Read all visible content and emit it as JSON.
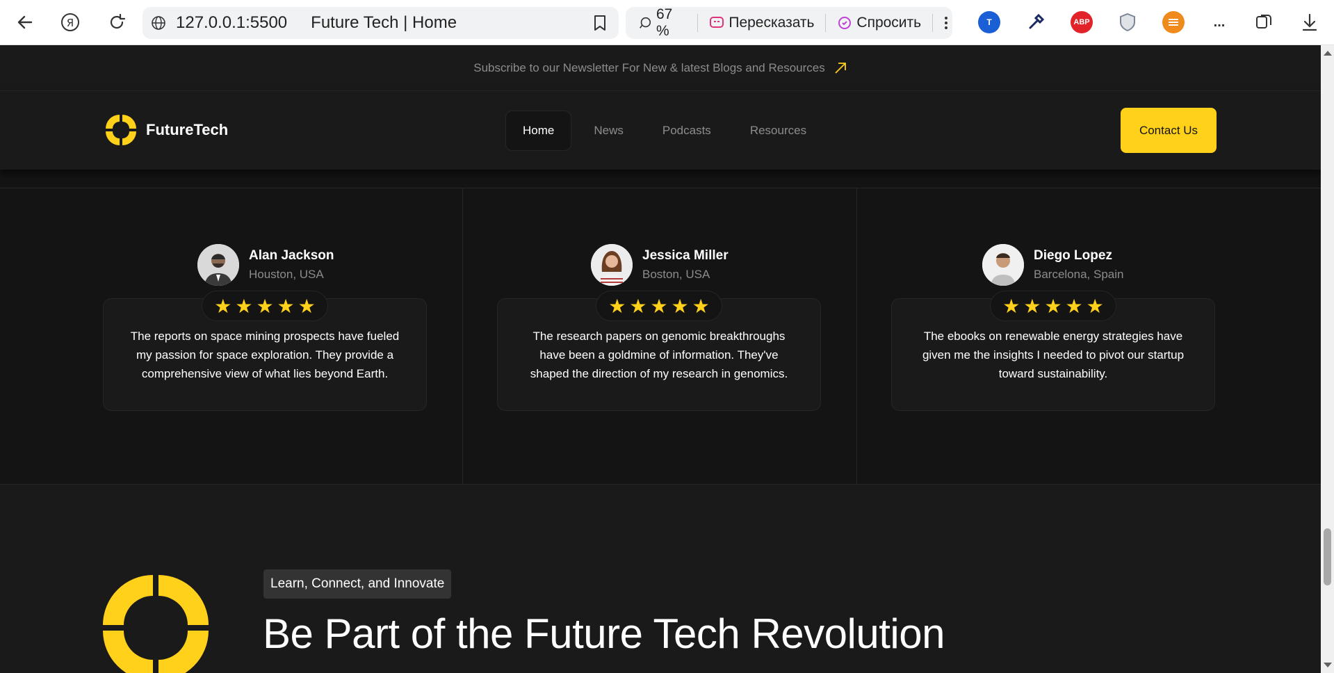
{
  "browser": {
    "url": "127.0.0.1:5500",
    "tab_title": "Future Tech | Home",
    "zoom": "67 %",
    "retell_label": "Пересказать",
    "ask_label": "Спросить",
    "more_label": "...",
    "abp_label": "ABP"
  },
  "newsletter": {
    "text": "Subscribe to our Newsletter For New & latest Blogs and Resources"
  },
  "header": {
    "brand": "FutureTech",
    "nav": [
      "Home",
      "News",
      "Podcasts",
      "Resources"
    ],
    "active_nav": "Home",
    "contact_label": "Contact Us",
    "accent_color": "#FFD11A"
  },
  "testimonials": [
    {
      "name": "Alan Jackson",
      "location": "Houston, USA",
      "rating": 5,
      "text": "The reports on space mining prospects have fueled my passion for space exploration. They provide a comprehensive view of what lies beyond Earth."
    },
    {
      "name": "Jessica Miller",
      "location": "Boston, USA",
      "rating": 5,
      "text": "The research papers on genomic breakthroughs have been a goldmine of information. They've shaped the direction of my research in genomics."
    },
    {
      "name": "Diego Lopez",
      "location": "Barcelona, Spain",
      "rating": 5,
      "text": "The ebooks on renewable energy strategies have given me the insights I needed to pivot our startup toward sustainability."
    }
  ],
  "cta": {
    "tag": "Learn, Connect, and Innovate",
    "title": "Be Part of the Future Tech Revolution"
  }
}
